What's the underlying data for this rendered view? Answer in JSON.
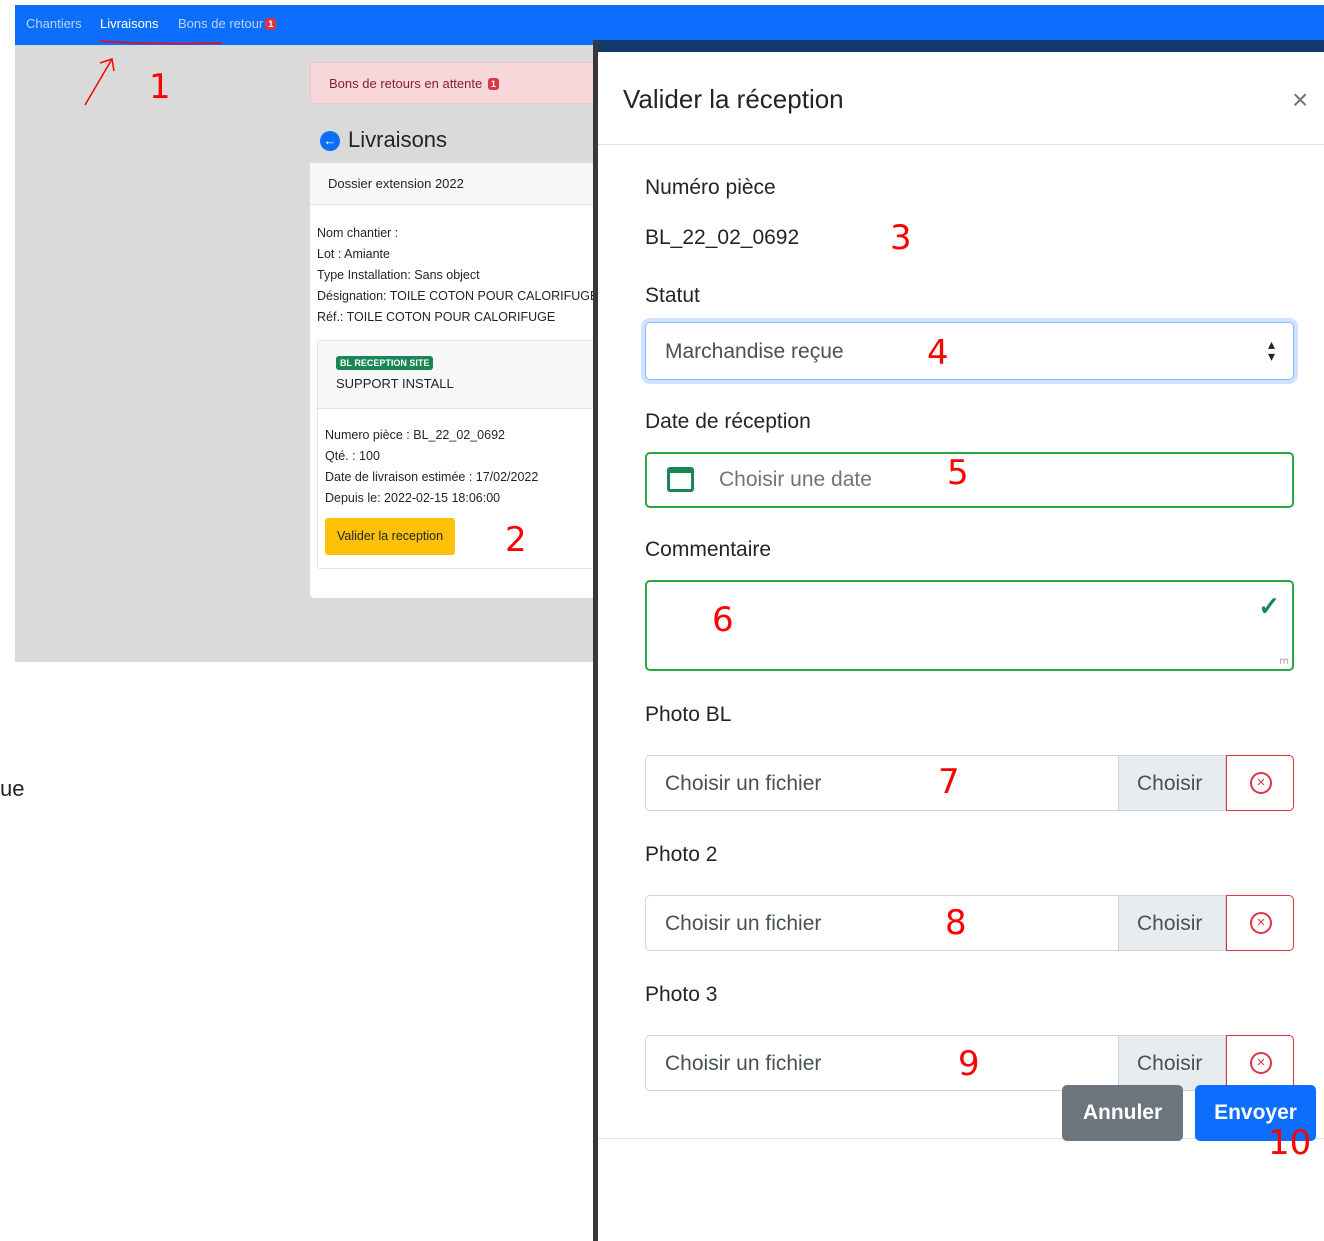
{
  "navbar": {
    "links": [
      "Chantiers",
      "Livraisons",
      "Bons de retour"
    ],
    "badge": "1"
  },
  "alert": {
    "text": "Bons de retours en attente",
    "badge": "1"
  },
  "page": {
    "title": "Livraisons"
  },
  "card": {
    "header": "Dossier extension 2022",
    "lines": [
      "Nom chantier :",
      "Lot : Amiante",
      "Type Installation: Sans object",
      "Désignation: TOILE COTON POUR CALORIFUGE",
      "Réf.: TOILE COTON POUR CALORIFUGE"
    ],
    "sub": {
      "badge": "BL RECEPTION SITE",
      "title": "SUPPORT INSTALL",
      "lines": [
        "Numero pièce : BL_22_02_0692",
        "Qté. : 100",
        "Date de livraison estimée : 17/02/2022",
        "Depuis le: 2022-02-15 18:06:00"
      ],
      "button": "Valider la reception"
    }
  },
  "side_text": "ue",
  "modal": {
    "title": "Valider la réception",
    "close": "×",
    "numero_label": "Numéro pièce",
    "numero_value": "BL_22_02_0692",
    "statut_label": "Statut",
    "statut_value": "Marchandise reçue",
    "date_label": "Date de réception",
    "date_placeholder": "Choisir une date",
    "comment_label": "Commentaire",
    "photos": [
      {
        "label": "Photo BL",
        "placeholder": "Choisir un fichier",
        "button": "Choisir"
      },
      {
        "label": "Photo 2",
        "placeholder": "Choisir un fichier",
        "button": "Choisir"
      },
      {
        "label": "Photo 3",
        "placeholder": "Choisir un fichier",
        "button": "Choisir"
      }
    ],
    "cancel": "Annuler",
    "submit": "Envoyer"
  },
  "annotations": [
    "1",
    "2",
    "3",
    "4",
    "5",
    "6",
    "7",
    "8",
    "9",
    "10"
  ],
  "colors": {
    "primary": "#0d6efd",
    "success": "#198754",
    "danger": "#dc3545",
    "warning": "#ffc107",
    "annotation": "#ff0000"
  }
}
